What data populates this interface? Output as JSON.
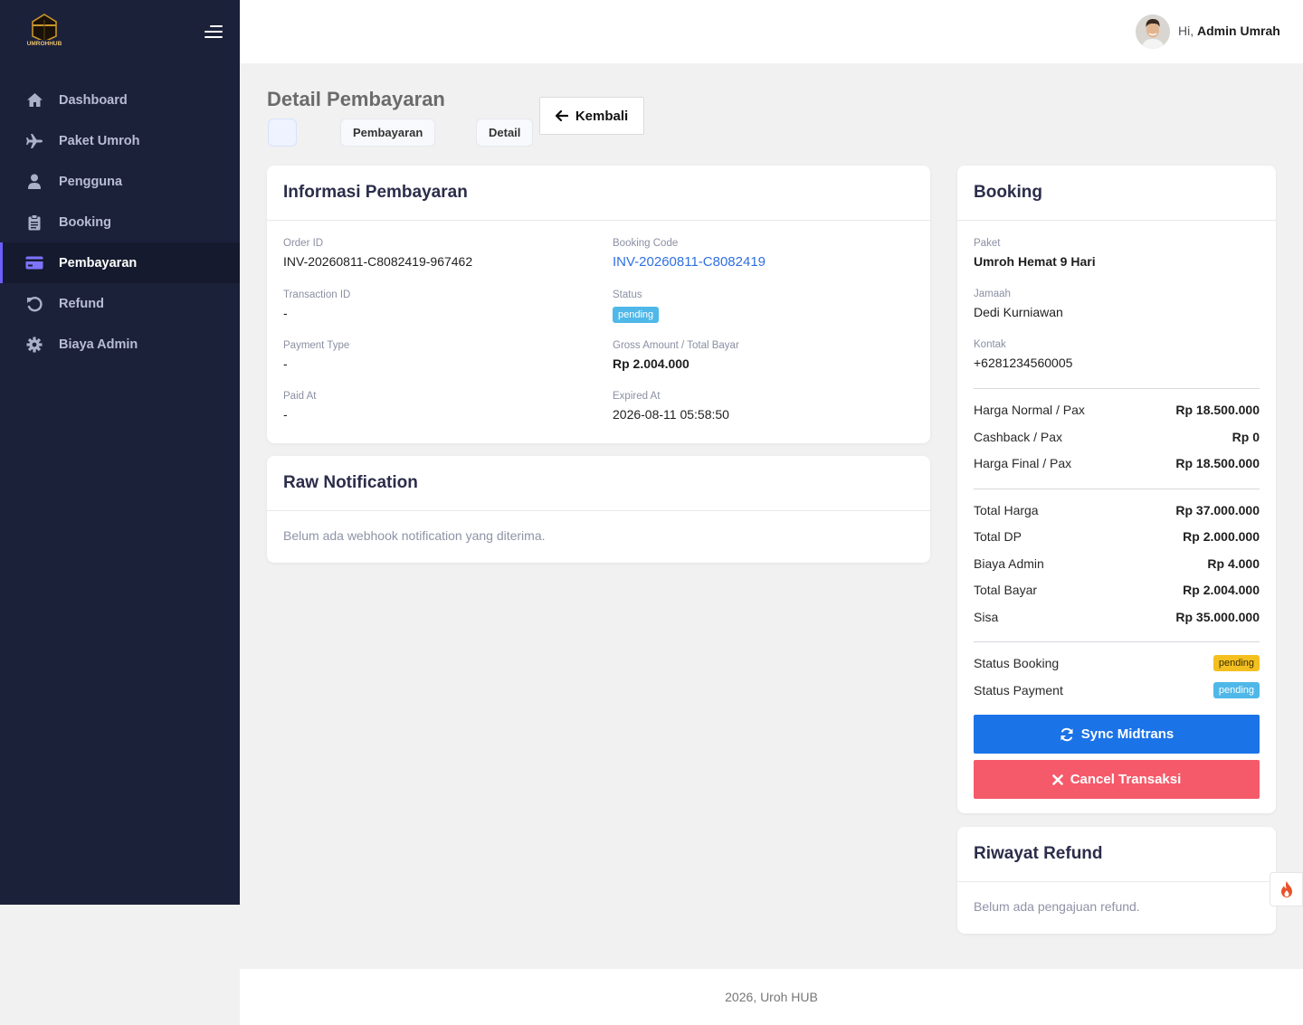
{
  "brand": {
    "logo_alt": "UMROH HUB",
    "accent": "#6c5ffc",
    "sidebar_bg": "#1c213a"
  },
  "sidebar": {
    "items": [
      {
        "label": "Dashboard",
        "icon": "home-icon"
      },
      {
        "label": "Paket Umroh",
        "icon": "plane-icon"
      },
      {
        "label": "Pengguna",
        "icon": "user-icon"
      },
      {
        "label": "Booking",
        "icon": "clipboard-icon"
      },
      {
        "label": "Pembayaran",
        "icon": "credit-card-icon",
        "active": true
      },
      {
        "label": "Refund",
        "icon": "undo-icon"
      },
      {
        "label": "Biaya Admin",
        "icon": "gear-icon"
      }
    ]
  },
  "topbar": {
    "greeting": "Hi,",
    "user_name": "Admin Umrah"
  },
  "page": {
    "title": "Detail Pembayaran",
    "breadcrumb": [
      "Pembayaran",
      "Detail"
    ],
    "back_label": "Kembali"
  },
  "payment_info": {
    "title": "Informasi Pembayaran",
    "order_id_label": "Order ID",
    "order_id": "INV-20260811-C8082419-967462",
    "booking_code_label": "Booking Code",
    "booking_code": "INV-20260811-C8082419",
    "transaction_id_label": "Transaction ID",
    "transaction_id": "-",
    "status_label": "Status",
    "status": "pending",
    "payment_type_label": "Payment Type",
    "payment_type": "-",
    "gross_amount_label": "Gross Amount / Total Bayar",
    "gross_amount": "Rp 2.004.000",
    "paid_at_label": "Paid At",
    "paid_at": "-",
    "expired_at_label": "Expired At",
    "expired_at": "2026-08-11 05:58:50"
  },
  "raw_notification": {
    "title": "Raw Notification",
    "empty_text": "Belum ada webhook notification yang diterima."
  },
  "booking": {
    "title": "Booking",
    "paket_label": "Paket",
    "paket": "Umroh Hemat 9 Hari",
    "jamaah_label": "Jamaah",
    "jamaah": "Dedi Kurniawan",
    "kontak_label": "Kontak",
    "kontak": "+6281234560005",
    "price_rows": [
      {
        "label": "Harga Normal / Pax",
        "value": "Rp 18.500.000"
      },
      {
        "label": "Cashback / Pax",
        "value": "Rp 0"
      },
      {
        "label": "Harga Final / Pax",
        "value": "Rp 18.500.000"
      }
    ],
    "total_rows": [
      {
        "label": "Total Harga",
        "value": "Rp 37.000.000"
      },
      {
        "label": "Total DP",
        "value": "Rp 2.000.000"
      },
      {
        "label": "Biaya Admin",
        "value": "Rp 4.000"
      },
      {
        "label": "Total Bayar",
        "value": "Rp 2.004.000"
      },
      {
        "label": "Sisa",
        "value": "Rp 35.000.000"
      }
    ],
    "status_booking_label": "Status Booking",
    "status_booking": "pending",
    "status_payment_label": "Status Payment",
    "status_payment": "pending",
    "sync_label": "Sync Midtrans",
    "cancel_label": "Cancel Transaksi"
  },
  "refund": {
    "title": "Riwayat Refund",
    "empty_text": "Belum ada pengajuan refund."
  },
  "footer": {
    "text": "2026, Uroh HUB"
  }
}
